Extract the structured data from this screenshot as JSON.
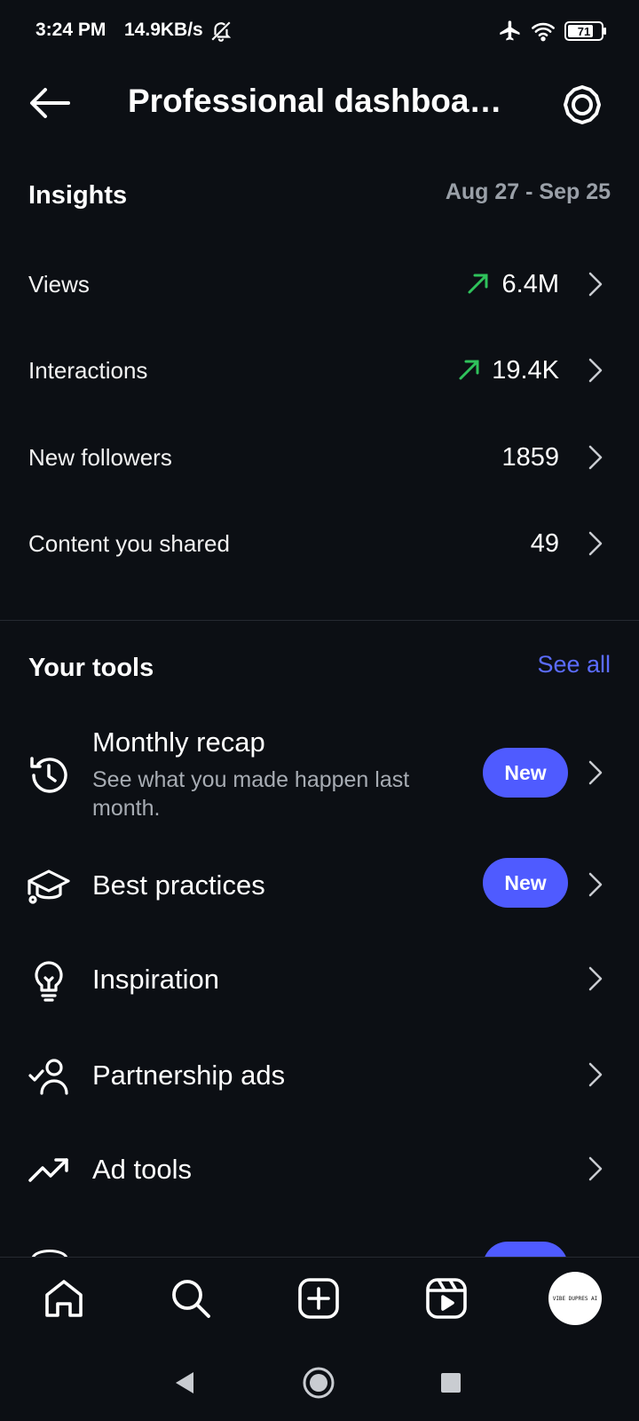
{
  "status_bar": {
    "time": "3:24 PM",
    "speed": "14.9KB/s",
    "battery": "71",
    "icons": [
      "bell-off-icon",
      "airplane-icon",
      "wifi-icon",
      "battery-icon"
    ]
  },
  "header": {
    "title": "Professional dashboa…",
    "back_icon": "arrow-left-icon",
    "settings_icon": "gear-icon"
  },
  "insights": {
    "heading": "Insights",
    "date_range": "Aug 27 - Sep 25",
    "rows": [
      {
        "label": "Views",
        "value": "6.4M",
        "trend": "up"
      },
      {
        "label": "Interactions",
        "value": "19.4K",
        "trend": "up"
      },
      {
        "label": "New followers",
        "value": "1859",
        "trend": null
      },
      {
        "label": "Content you shared",
        "value": "49",
        "trend": null
      }
    ]
  },
  "tools": {
    "heading": "Your tools",
    "see_all": "See all",
    "items": [
      {
        "title": "Monthly recap",
        "subtitle": "See what you made happen last month.",
        "badge": "New",
        "icon": "history-clock-icon"
      },
      {
        "title": "Best practices",
        "badge": "New",
        "icon": "graduation-cap-icon"
      },
      {
        "title": "Inspiration",
        "icon": "lightbulb-icon"
      },
      {
        "title": "Partnership ads",
        "icon": "user-check-icon"
      },
      {
        "title": "Ad tools",
        "icon": "trend-up-icon"
      }
    ]
  },
  "bottom_nav": {
    "items": [
      "home-icon",
      "search-icon",
      "create-icon",
      "reels-icon",
      "profile-avatar"
    ],
    "avatar_text": "VIBE DUPRES AI"
  },
  "colors": {
    "background": "#0c0f14",
    "accent": "#4f5bff",
    "link": "#5b6cff",
    "trend_up": "#2fc25b",
    "muted": "#9aa0a8"
  }
}
